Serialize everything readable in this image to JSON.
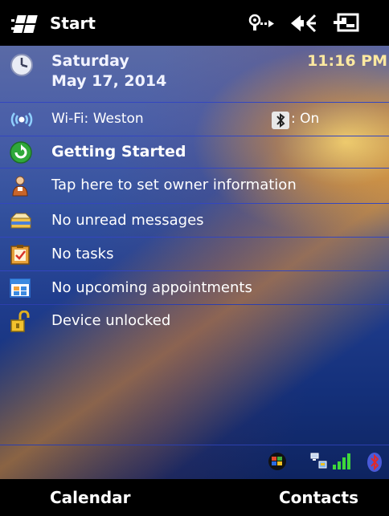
{
  "titlebar": {
    "title": "Start",
    "icons": [
      "windows-logo-icon",
      "connectivity-icon",
      "volume-icon",
      "battery-icon"
    ]
  },
  "today": {
    "day": "Saturday",
    "date": "May 17, 2014",
    "time": "11:16 PM",
    "wifi_label": "Wi-Fi: Weston",
    "bluetooth_label": ": On",
    "getting_started": "Getting Started",
    "owner_info": "Tap here to set owner information",
    "messages": "No unread messages",
    "tasks": "No tasks",
    "appointments": "No upcoming appointments",
    "device_lock": "Device unlocked"
  },
  "tray": {
    "icons": [
      "windows-flag-icon",
      "network-icon",
      "signal-strength-icon",
      "bluetooth-icon"
    ]
  },
  "softkeys": {
    "left": "Calendar",
    "right": "Contacts"
  },
  "colors": {
    "row_divider": "#3346c0",
    "time_text": "#fde9a0",
    "bar_background": "#000000"
  }
}
